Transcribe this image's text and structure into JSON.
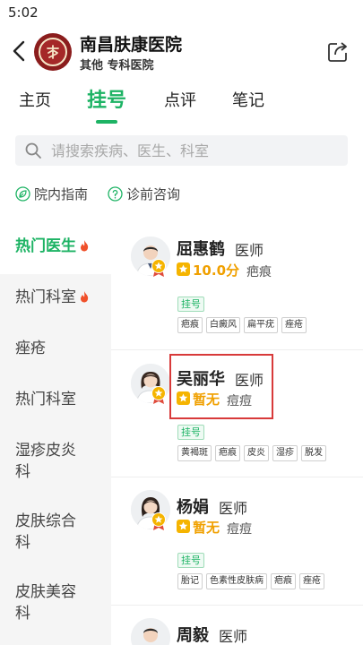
{
  "status_bar": {
    "time": "5:02"
  },
  "header": {
    "hospital_name": "南昌肤康医院",
    "subtitle": "其他 专科医院",
    "logo_char": "皮"
  },
  "tabs": [
    {
      "label": "主页",
      "active": false
    },
    {
      "label": "挂号",
      "active": true
    },
    {
      "label": "点评",
      "active": false
    },
    {
      "label": "笔记",
      "active": false
    }
  ],
  "search": {
    "placeholder": "请搜索疾病、医生、科室"
  },
  "quick_links": [
    {
      "label": "院内指南",
      "icon": "leaf-icon"
    },
    {
      "label": "诊前咨询",
      "icon": "question-circle-icon"
    }
  ],
  "sidebar": {
    "items": [
      {
        "label": "热门医生",
        "active": true,
        "hot": true
      },
      {
        "label": "热门科室",
        "active": false,
        "hot": true
      },
      {
        "label": "痤疮",
        "active": false,
        "hot": false
      },
      {
        "label": "热门科室",
        "active": false,
        "hot": false
      },
      {
        "label": "湿疹皮炎科",
        "active": false,
        "hot": false
      },
      {
        "label": "皮肤综合科",
        "active": false,
        "hot": false
      },
      {
        "label": "皮肤美容科",
        "active": false,
        "hot": false
      }
    ]
  },
  "doctors": [
    {
      "name": "屈惠鹤",
      "title": "医师",
      "rating": "10.0分",
      "specialty": "疤痕",
      "badge": "挂号",
      "tags": [
        "疤痕",
        "白癜风",
        "扁平疣",
        "痤疮"
      ],
      "gender": "male"
    },
    {
      "name": "吴丽华",
      "title": "医师",
      "rating": "暂无",
      "specialty": "痘痘",
      "badge": "挂号",
      "tags": [
        "黄褐斑",
        "疤痕",
        "皮炎",
        "湿疹",
        "脱发"
      ],
      "gender": "female"
    },
    {
      "name": "杨娟",
      "title": "医师",
      "rating": "暂无",
      "specialty": "痘痘",
      "badge": "挂号",
      "tags": [
        "胎记",
        "色素性皮肤病",
        "疤痕",
        "痤疮"
      ],
      "gender": "female"
    },
    {
      "name": "周毅",
      "title": "医师",
      "gender": "male"
    }
  ],
  "colors": {
    "accent": "#1db364",
    "rating": "#f0a000",
    "highlight": "#d83a3a",
    "hot": "#f0502a"
  }
}
